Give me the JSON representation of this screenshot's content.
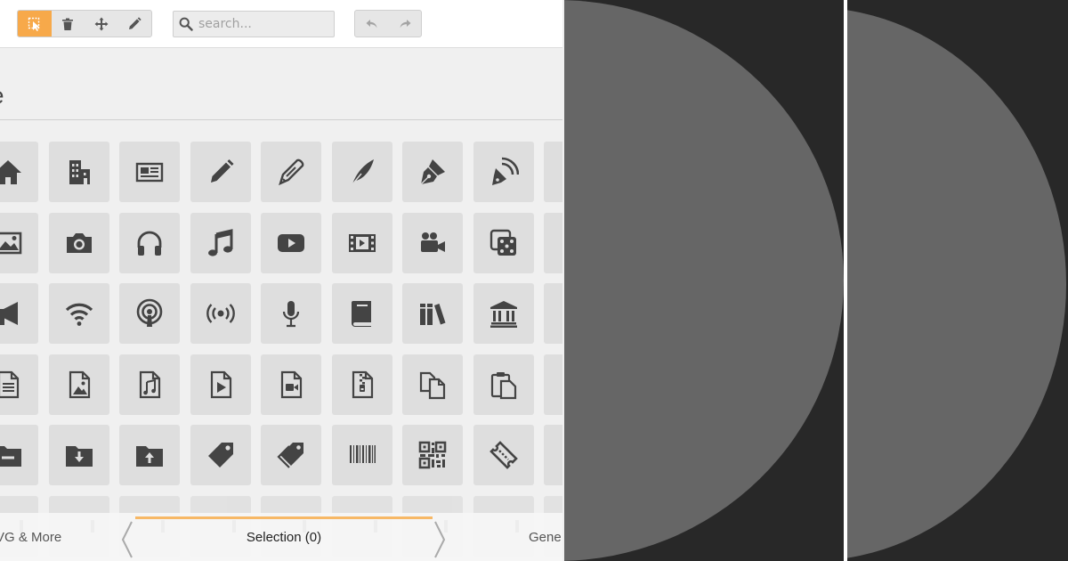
{
  "toolbar": {
    "tools": [
      {
        "name": "select-tool",
        "icon": "cursor-icon",
        "active": true
      },
      {
        "name": "delete-tool",
        "icon": "trash-icon",
        "active": false
      },
      {
        "name": "move-tool",
        "icon": "move-icon",
        "active": false
      },
      {
        "name": "edit-tool",
        "icon": "pencil-icon",
        "active": false
      }
    ],
    "search_placeholder": "search...",
    "undo_icon": "undo-icon",
    "redo_icon": "redo-icon",
    "accent_color": "#f7a94a"
  },
  "section": {
    "title_fragment": "e"
  },
  "icon_grid": [
    [
      "home-icon",
      "office-building-icon",
      "newspaper-icon",
      "pencil-icon",
      "quill-pen-icon",
      "feather-icon",
      "fountain-pen-icon",
      "blog-icon",
      "partial-icon"
    ],
    [
      "image-icon",
      "camera-icon",
      "headphones-icon",
      "music-note-icon",
      "play-button-icon",
      "film-icon",
      "video-camera-icon",
      "dice-icon",
      "partial-icon"
    ],
    [
      "megaphone-icon",
      "wifi-icon",
      "podcast-icon",
      "broadcast-icon",
      "microphone-icon",
      "book-icon",
      "books-icon",
      "library-icon",
      "partial-icon"
    ],
    [
      "file-text-icon",
      "file-image-icon",
      "file-music-icon",
      "file-play-icon",
      "file-video-icon",
      "file-zip-icon",
      "copy-icon",
      "paste-icon",
      "partial-icon"
    ],
    [
      "folder-minus-icon",
      "folder-download-icon",
      "folder-upload-icon",
      "price-tag-icon",
      "price-tags-icon",
      "barcode-icon",
      "qr-code-icon",
      "ticket-icon",
      "partial-icon"
    ],
    [
      "partial-icon",
      "partial-icon",
      "partial-icon",
      "partial-icon",
      "partial-icon",
      "partial-icon",
      "partial-icon",
      "partial-icon",
      "partial-icon"
    ]
  ],
  "bottom_bar": {
    "left_tab": "VG & More",
    "selection_tab": "Selection (0)",
    "right_tab": "Gene",
    "prev_icon": "chevron-left-icon",
    "next_icon": "chevron-right-icon"
  },
  "preview": {
    "panel_color": "#282828",
    "shape_color": "#666666",
    "separator_color": "#ffffff"
  }
}
